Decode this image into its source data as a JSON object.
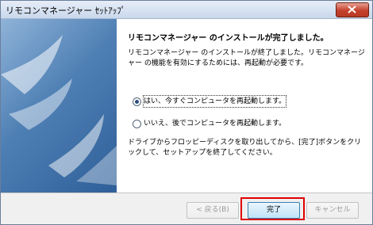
{
  "window": {
    "title": "リモコンマネージャー ｾｯﾄｱｯﾌﾟ"
  },
  "content": {
    "heading": "リモコンマネージャー のインストールが完了しました。",
    "description": "リモコンマネージャー のインストールが終了しました。リモコンマネージャー の機能を有効にするためには、再起動が必要です。",
    "options": [
      {
        "label": "はい、今すぐコンピュータを再起動します。",
        "selected": true
      },
      {
        "label": "いいえ、後でコンピュータを再起動します。",
        "selected": false
      }
    ],
    "instruction": "ドライブからフロッピーディスクを取り出してから、[完了]ボタンをクリックして、セットアップを終了してください。"
  },
  "buttons": {
    "back": "< 戻る(B)",
    "finish": "完了",
    "cancel": "キャンセル"
  },
  "colors": {
    "highlight_box": "#e00000",
    "banner": "#3e6ea6"
  }
}
